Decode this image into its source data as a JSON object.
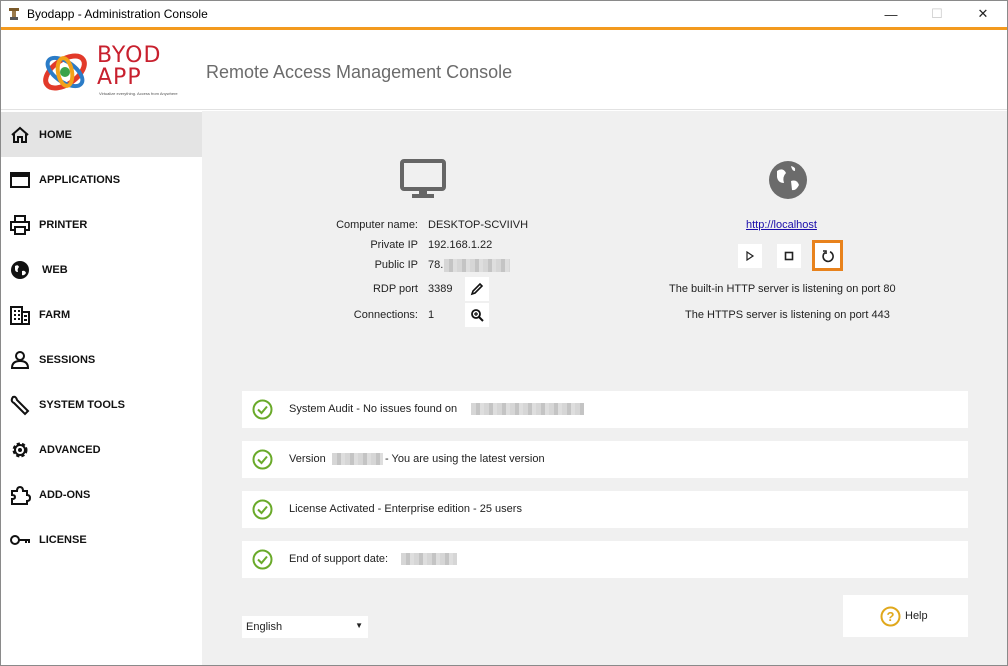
{
  "window": {
    "title": "Byodapp - Administration Console",
    "minimize_glyph": "—",
    "maximize_glyph": "☐",
    "close_glyph": "✕"
  },
  "colors": {
    "accent": "#f39a1e",
    "highlight": "#e8821c",
    "check": "#6aaa2a",
    "help": "#e0a81c",
    "sidebar_active": "#e4e4e4",
    "main_bg": "#f0f0f0"
  },
  "header": {
    "logo_text_line1": "BYOD",
    "logo_text_line2": "APP",
    "logo_tagline": "Virtualize everything. Access from Anywhere",
    "title": "Remote Access Management Console"
  },
  "sidebar": {
    "items": [
      {
        "label": "HOME",
        "icon": "home-icon",
        "active": true
      },
      {
        "label": "APPLICATIONS",
        "icon": "window-icon",
        "active": false
      },
      {
        "label": "PRINTER",
        "icon": "printer-icon",
        "active": false
      },
      {
        "label": "WEB",
        "icon": "globe-icon",
        "active": false
      },
      {
        "label": "FARM",
        "icon": "building-icon",
        "active": false
      },
      {
        "label": "SESSIONS",
        "icon": "user-icon",
        "active": false
      },
      {
        "label": "SYSTEM TOOLS",
        "icon": "wrench-icon",
        "active": false
      },
      {
        "label": "ADVANCED",
        "icon": "gear-icon",
        "active": false
      },
      {
        "label": "ADD-ONS",
        "icon": "puzzle-icon",
        "active": false
      },
      {
        "label": "LICENSE",
        "icon": "key-icon",
        "active": false
      }
    ]
  },
  "computer": {
    "icon": "monitor-icon",
    "name_label": "Computer name:",
    "name_value": "DESKTOP-SCVIIVH",
    "private_ip_label": "Private IP",
    "private_ip_value": "192.168.1.22",
    "public_ip_label": "Public IP",
    "public_ip_value": "78.",
    "rdp_label": "RDP port",
    "rdp_value": "3389",
    "connections_label": "Connections:",
    "connections_value": "1"
  },
  "web_server": {
    "icon": "globe-icon",
    "link": "http://localhost",
    "http_status": "The built-in HTTP server is listening on port 80",
    "https_status": "The HTTPS server is listening on port 443"
  },
  "status": {
    "audit": "System Audit - No issues found on",
    "version_prefix": "Version",
    "version_suffix": "- You are using the latest version",
    "license": "License Activated - Enterprise edition - 25 users",
    "support": "End of support date:"
  },
  "footer": {
    "language": "English",
    "help_label": "Help",
    "help_glyph": "?"
  }
}
